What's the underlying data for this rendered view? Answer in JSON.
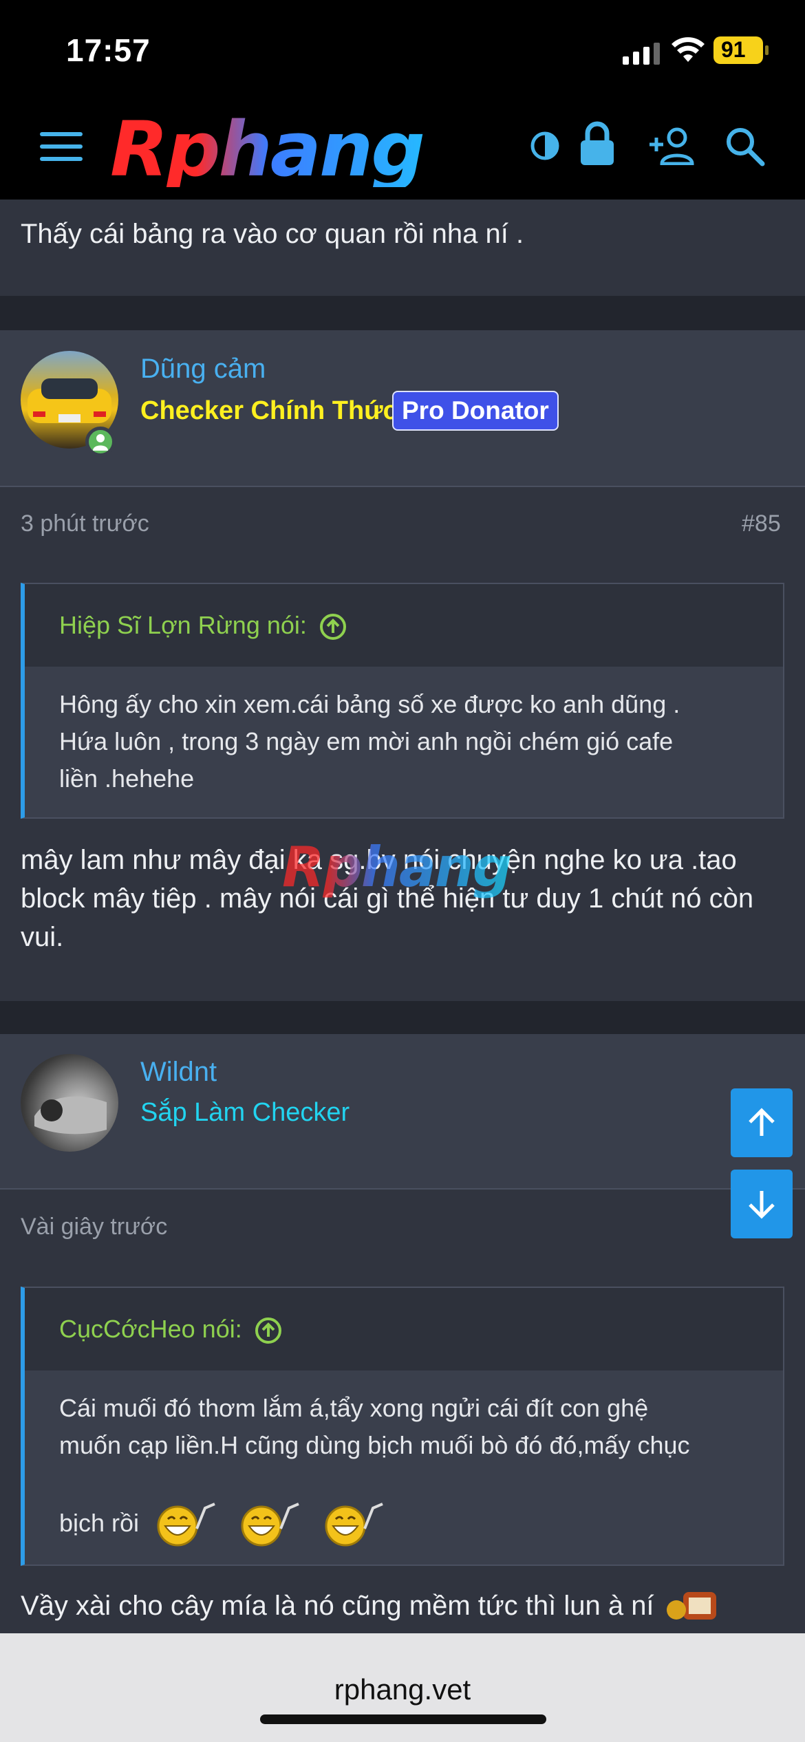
{
  "status_bar": {
    "time": "17:57",
    "battery": "91"
  },
  "site": {
    "logo": "Rphang",
    "url": "rphang.vet"
  },
  "previous_post": {
    "text": "Thấy cái bảng ra vào cơ quan rồi nha ní ."
  },
  "posts": [
    {
      "username": "Dũng cảm",
      "user_title": "Checker Chính Thức",
      "badge": "Pro Donator",
      "time": "3 phút trước",
      "post_number": "#85",
      "quote_author": "Hiệp Sĩ Lợn Rừng nói:",
      "quote_lines": [
        "Hông ấy cho xin xem.cái bảng số xe được ko anh dũng .",
        "Hứa luôn , trong 3 ngày em mời anh ngồi chém gió cafe",
        "liền .hehehe"
      ],
      "body_lines": [
        "mây lam như mây đại ka sg.bv nói chuyện nghe ko ưa .tao",
        "block mây tiêp . mây nói cái gì thể hiện tư duy 1 chút nó còn",
        "vui."
      ]
    },
    {
      "username": "Wildnt",
      "user_title": "Sắp Làm Checker",
      "time": "Vài giây trước",
      "quote_author": "CụcCớcHeo nói:",
      "quote_lines": [
        "Cái muối đó thơm lắm á,tẩy xong ngửi cái đít con ghệ",
        "muốn cạp liền.H cũng dùng bịch muối bò đó đó,mấy chục",
        "bịch rồi"
      ],
      "body_line": "Vầy xài cho cây mía là nó cũng mềm tức thì lun à ní"
    }
  ],
  "colors": {
    "accent": "#49b0f0",
    "quote_author": "#8fd14f",
    "yellow_title": "#fff020",
    "cyan_title": "#22d4f0"
  }
}
